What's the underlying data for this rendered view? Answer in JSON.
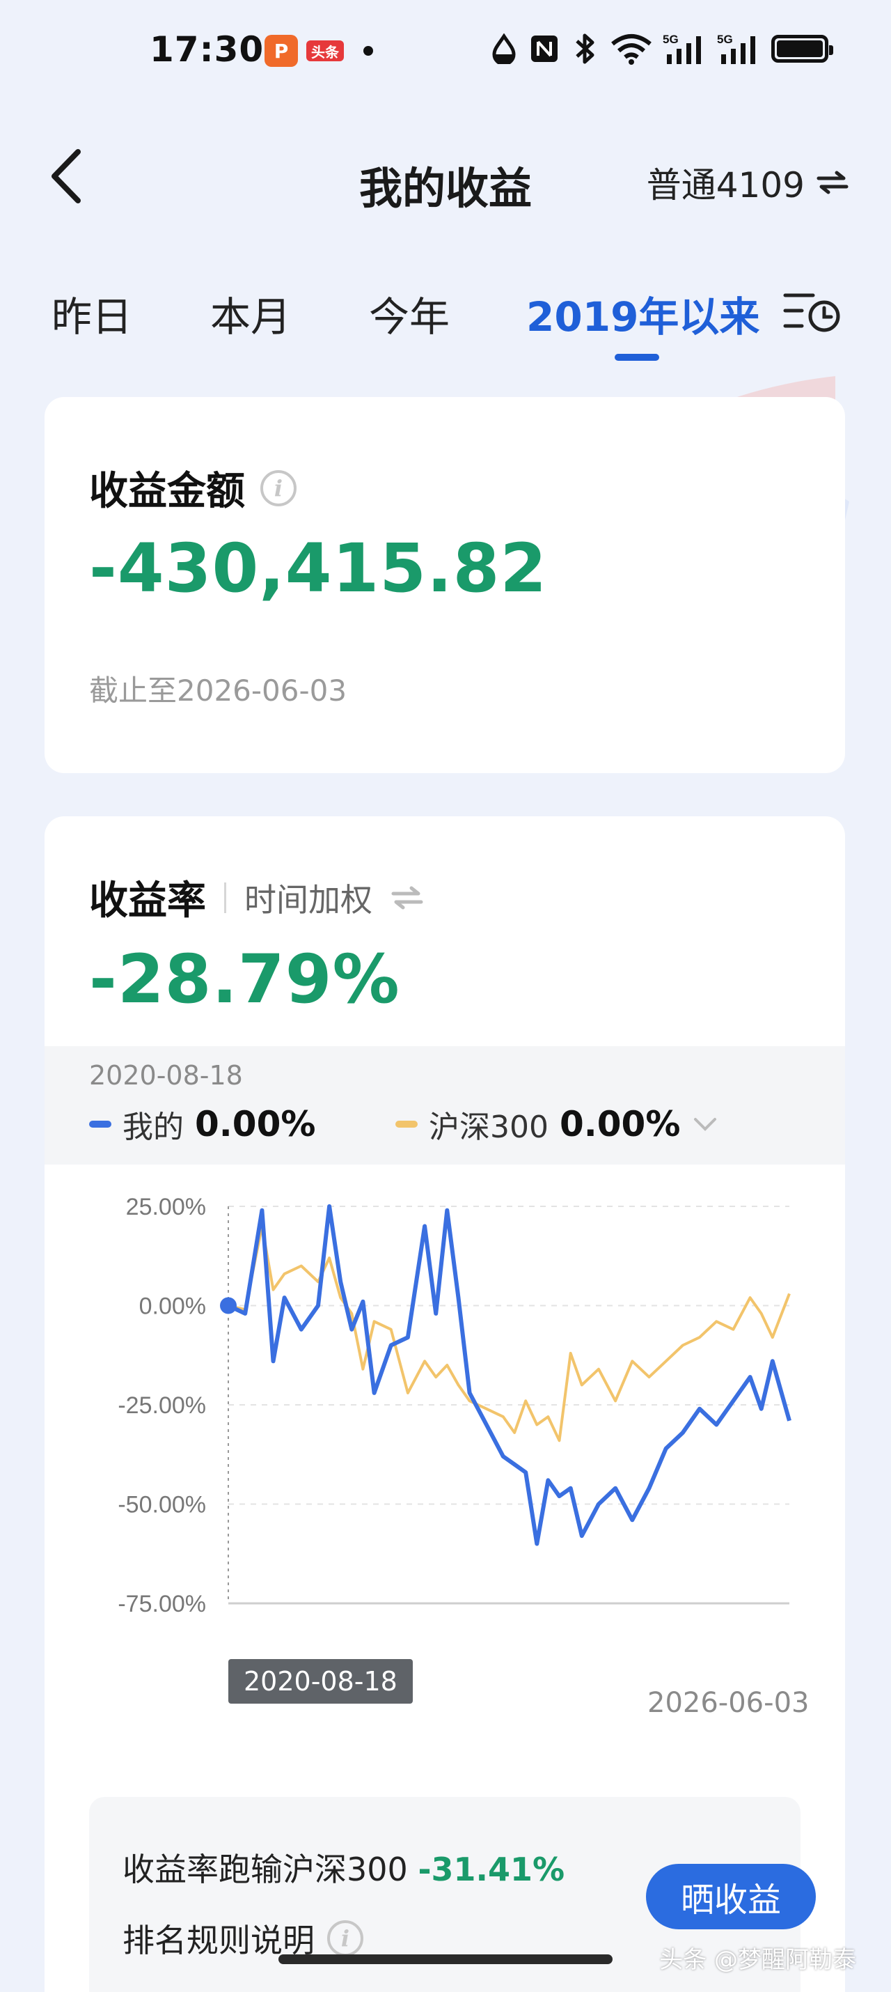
{
  "status_bar": {
    "time": "17:30",
    "app_icon_1": "p-app-icon",
    "app_icon_2_text": "头条",
    "net1": "5G",
    "net2": "5G"
  },
  "header": {
    "title": "我的收益",
    "account": "普通4109"
  },
  "tabs": [
    {
      "label": "昨日",
      "active": false
    },
    {
      "label": "本月",
      "active": false
    },
    {
      "label": "今年",
      "active": false
    },
    {
      "label": "2019年以来",
      "active": true
    }
  ],
  "earnings_card": {
    "label": "收益金额",
    "amount": "-430,415.82",
    "as_of": "截止至2026-06-03"
  },
  "return_card": {
    "label": "收益率",
    "mode": "时间加权",
    "rate": "-28.79%",
    "legend_date": "2020-08-18",
    "mine_label": "我的",
    "mine_value": "0.00%",
    "index_label": "沪深300",
    "index_value": "0.00%",
    "x_start": "2020-08-18",
    "x_end": "2026-06-03",
    "rank_prefix": "收益率跑输沪深300",
    "rank_value": "-31.41%",
    "rank_rule": "排名规则说明",
    "share_button": "晒收益"
  },
  "colors": {
    "accent": "#1f5fd8",
    "negative_green": "#1a9a6a",
    "mine_line": "#3a6fe0",
    "index_line": "#f2c46b"
  },
  "chart_data": {
    "type": "line",
    "y_ticks": [
      "25.00%",
      "0.00%",
      "-25.00%",
      "-50.00%",
      "-75.00%"
    ],
    "ylim": [
      -75,
      25
    ],
    "x_range": [
      "2020-08-18",
      "2026-06-03"
    ],
    "series": [
      {
        "name": "我的",
        "x": [
          0,
          0.03,
          0.06,
          0.08,
          0.1,
          0.13,
          0.16,
          0.18,
          0.2,
          0.22,
          0.24,
          0.26,
          0.29,
          0.32,
          0.35,
          0.37,
          0.39,
          0.41,
          0.43,
          0.46,
          0.49,
          0.51,
          0.53,
          0.55,
          0.57,
          0.59,
          0.61,
          0.63,
          0.66,
          0.69,
          0.72,
          0.75,
          0.78,
          0.81,
          0.84,
          0.87,
          0.9,
          0.93,
          0.95,
          0.97,
          1.0
        ],
        "values": [
          0,
          -2,
          24,
          -14,
          2,
          -6,
          0,
          25,
          6,
          -6,
          1,
          -22,
          -10,
          -8,
          20,
          -2,
          24,
          2,
          -22,
          -30,
          -38,
          -40,
          -42,
          -60,
          -44,
          -48,
          -46,
          -58,
          -50,
          -46,
          -54,
          -46,
          -36,
          -32,
          -26,
          -30,
          -24,
          -18,
          -26,
          -14,
          -29
        ]
      },
      {
        "name": "沪深300",
        "x": [
          0,
          0.03,
          0.06,
          0.08,
          0.1,
          0.13,
          0.16,
          0.18,
          0.2,
          0.22,
          0.24,
          0.26,
          0.29,
          0.32,
          0.35,
          0.37,
          0.39,
          0.41,
          0.43,
          0.46,
          0.49,
          0.51,
          0.53,
          0.55,
          0.57,
          0.59,
          0.61,
          0.63,
          0.66,
          0.69,
          0.72,
          0.75,
          0.78,
          0.81,
          0.84,
          0.87,
          0.9,
          0.93,
          0.95,
          0.97,
          1.0
        ],
        "values": [
          0,
          -1,
          20,
          4,
          8,
          10,
          6,
          12,
          2,
          -2,
          -16,
          -4,
          -6,
          -22,
          -14,
          -18,
          -15,
          -20,
          -24,
          -26,
          -28,
          -32,
          -24,
          -30,
          -28,
          -34,
          -12,
          -20,
          -16,
          -24,
          -14,
          -18,
          -14,
          -10,
          -8,
          -4,
          -6,
          2,
          -2,
          -8,
          3
        ]
      }
    ]
  }
}
